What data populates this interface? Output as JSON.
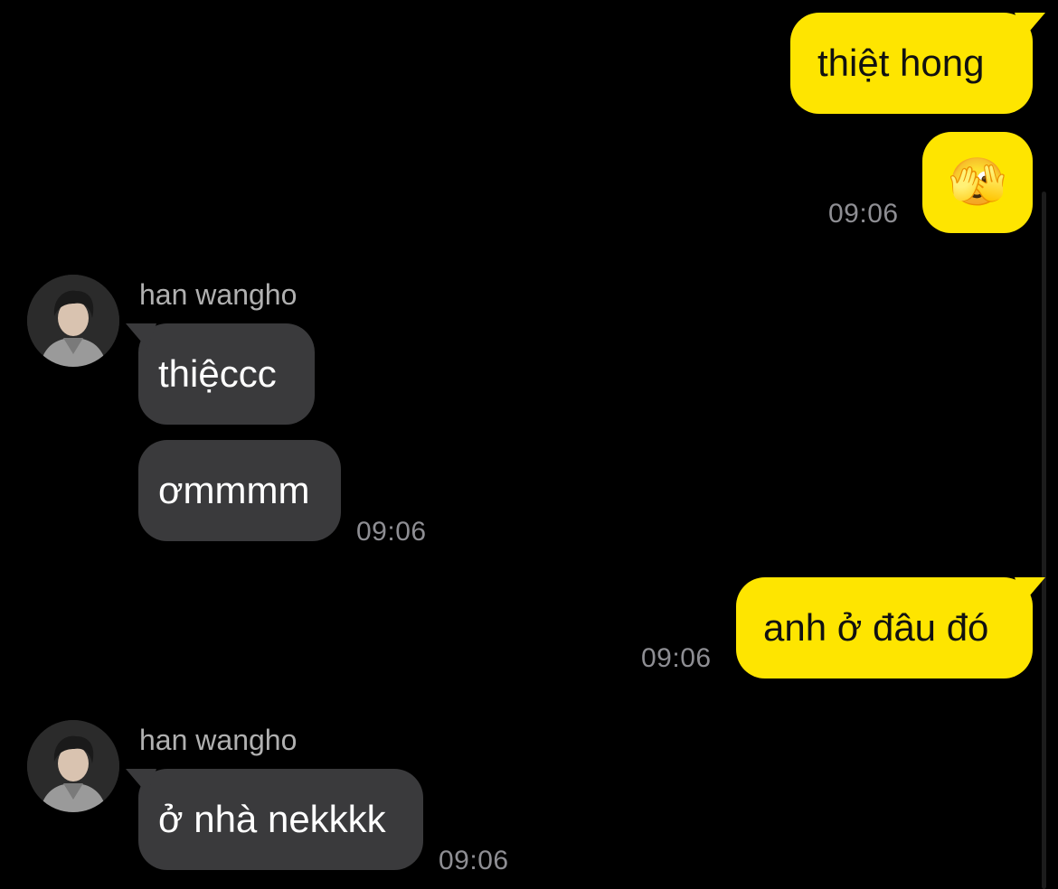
{
  "app": {
    "accent_color": "#FEE500",
    "incoming_bubble_color": "#3A3A3C",
    "background": "#000000"
  },
  "messages": [
    {
      "from": "me",
      "text": "thiệt hong"
    },
    {
      "from": "me",
      "text": "🫣",
      "time": "09:06"
    },
    {
      "from": "them",
      "sender": "han wangho",
      "text": "thiệccc"
    },
    {
      "from": "them",
      "text": "ơmmmm",
      "time": "09:06"
    },
    {
      "from": "me",
      "text": "anh ở đâu đó",
      "time": "09:06"
    },
    {
      "from": "them",
      "sender": "han wangho",
      "text": "ở nhà nekkkk",
      "time": "09:06"
    }
  ]
}
